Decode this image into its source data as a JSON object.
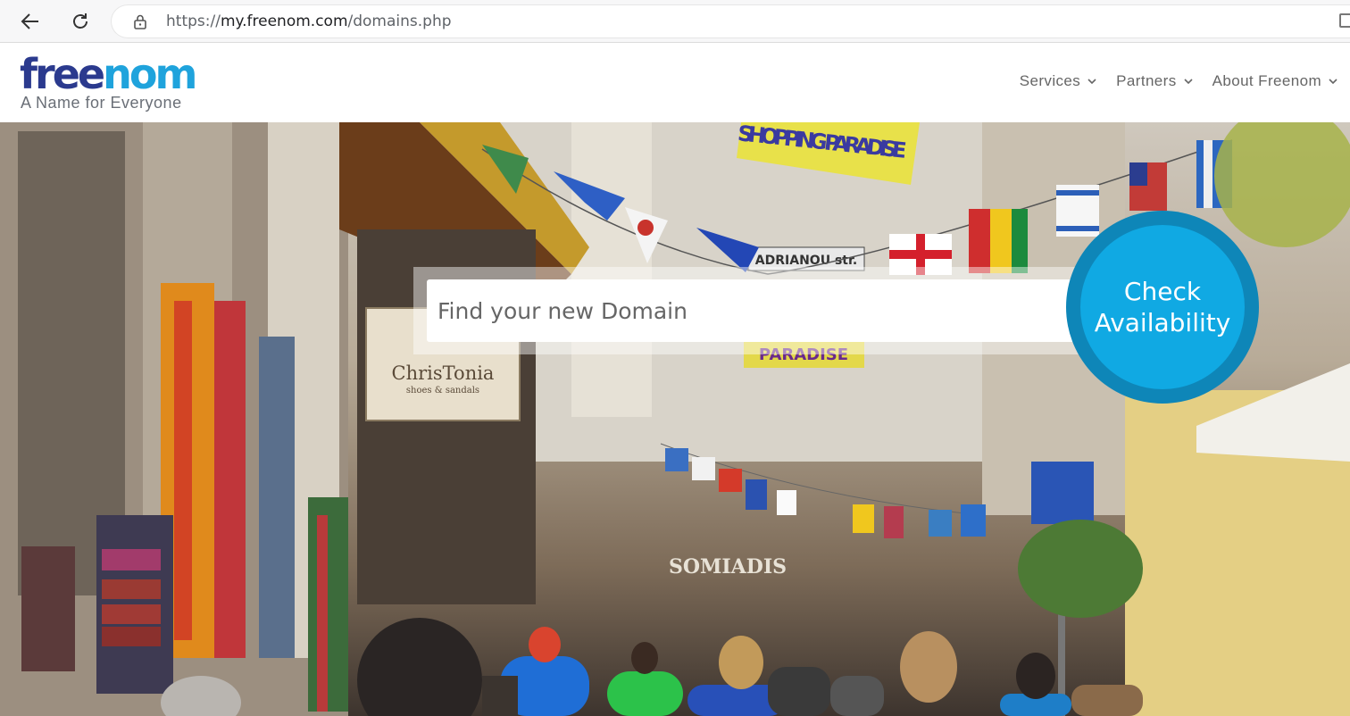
{
  "browser": {
    "url_prefix": "https://",
    "url_host": "my.freenom.com",
    "url_path": "/domains.php",
    "icons": [
      "back-arrow-icon",
      "reload-icon",
      "lock-icon"
    ]
  },
  "header": {
    "logo_part1": "free",
    "logo_part2": "nom",
    "tagline": "A Name for Everyone",
    "nav": [
      {
        "label": "Services"
      },
      {
        "label": "Partners"
      },
      {
        "label": "About Freenom"
      }
    ],
    "colors": {
      "logo_dark": "#2b3a8e",
      "logo_light": "#1fa3dc"
    }
  },
  "hero": {
    "search_placeholder": "Find your new Domain",
    "check_button_label": "Check Availability",
    "signs": {
      "banner_top": "SHOPPING PARADISE",
      "street_sign": "ADRIANOU str.",
      "banner_lower": "PARADISE",
      "shop_sign_name": "ChrisTonia",
      "shop_sign_sub": "shoes & sandals",
      "storefront": "SOMIADIS"
    },
    "colors": {
      "button_outer": "#0e86b8",
      "button_inner": "#10a9e3"
    }
  }
}
